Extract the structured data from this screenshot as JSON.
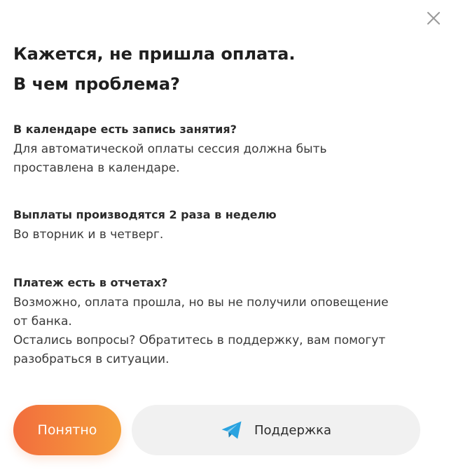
{
  "dialog": {
    "title_line1": "Кажется, не пришла оплата.",
    "title_line2": "В чем проблема?",
    "close_icon": "close-icon"
  },
  "sections": [
    {
      "title": "В календаре есть запись занятия?",
      "text_lines": [
        "Для автоматической оплаты сессия должна быть",
        "проставлена в календаре."
      ]
    },
    {
      "title": "Выплаты производятся 2 раза в неделю",
      "text_lines": [
        "Во вторник и в четверг."
      ]
    },
    {
      "title": "Платеж есть в отчетах?",
      "text_lines": [
        "Возможно, оплата прошла, но вы не получили оповещение",
        "от банка.",
        "Остались вопросы? Обратитесь в поддержку, вам помогут",
        "разобраться в ситуации."
      ]
    }
  ],
  "buttons": {
    "ok_label": "Понятно",
    "support_label": "Поддержка",
    "support_icon": "telegram-icon"
  },
  "colors": {
    "accent_start": "#f26d3d",
    "accent_end": "#f5a13c",
    "support_bg": "#f1f1f1",
    "telegram_blue": "#2aa3e0"
  }
}
